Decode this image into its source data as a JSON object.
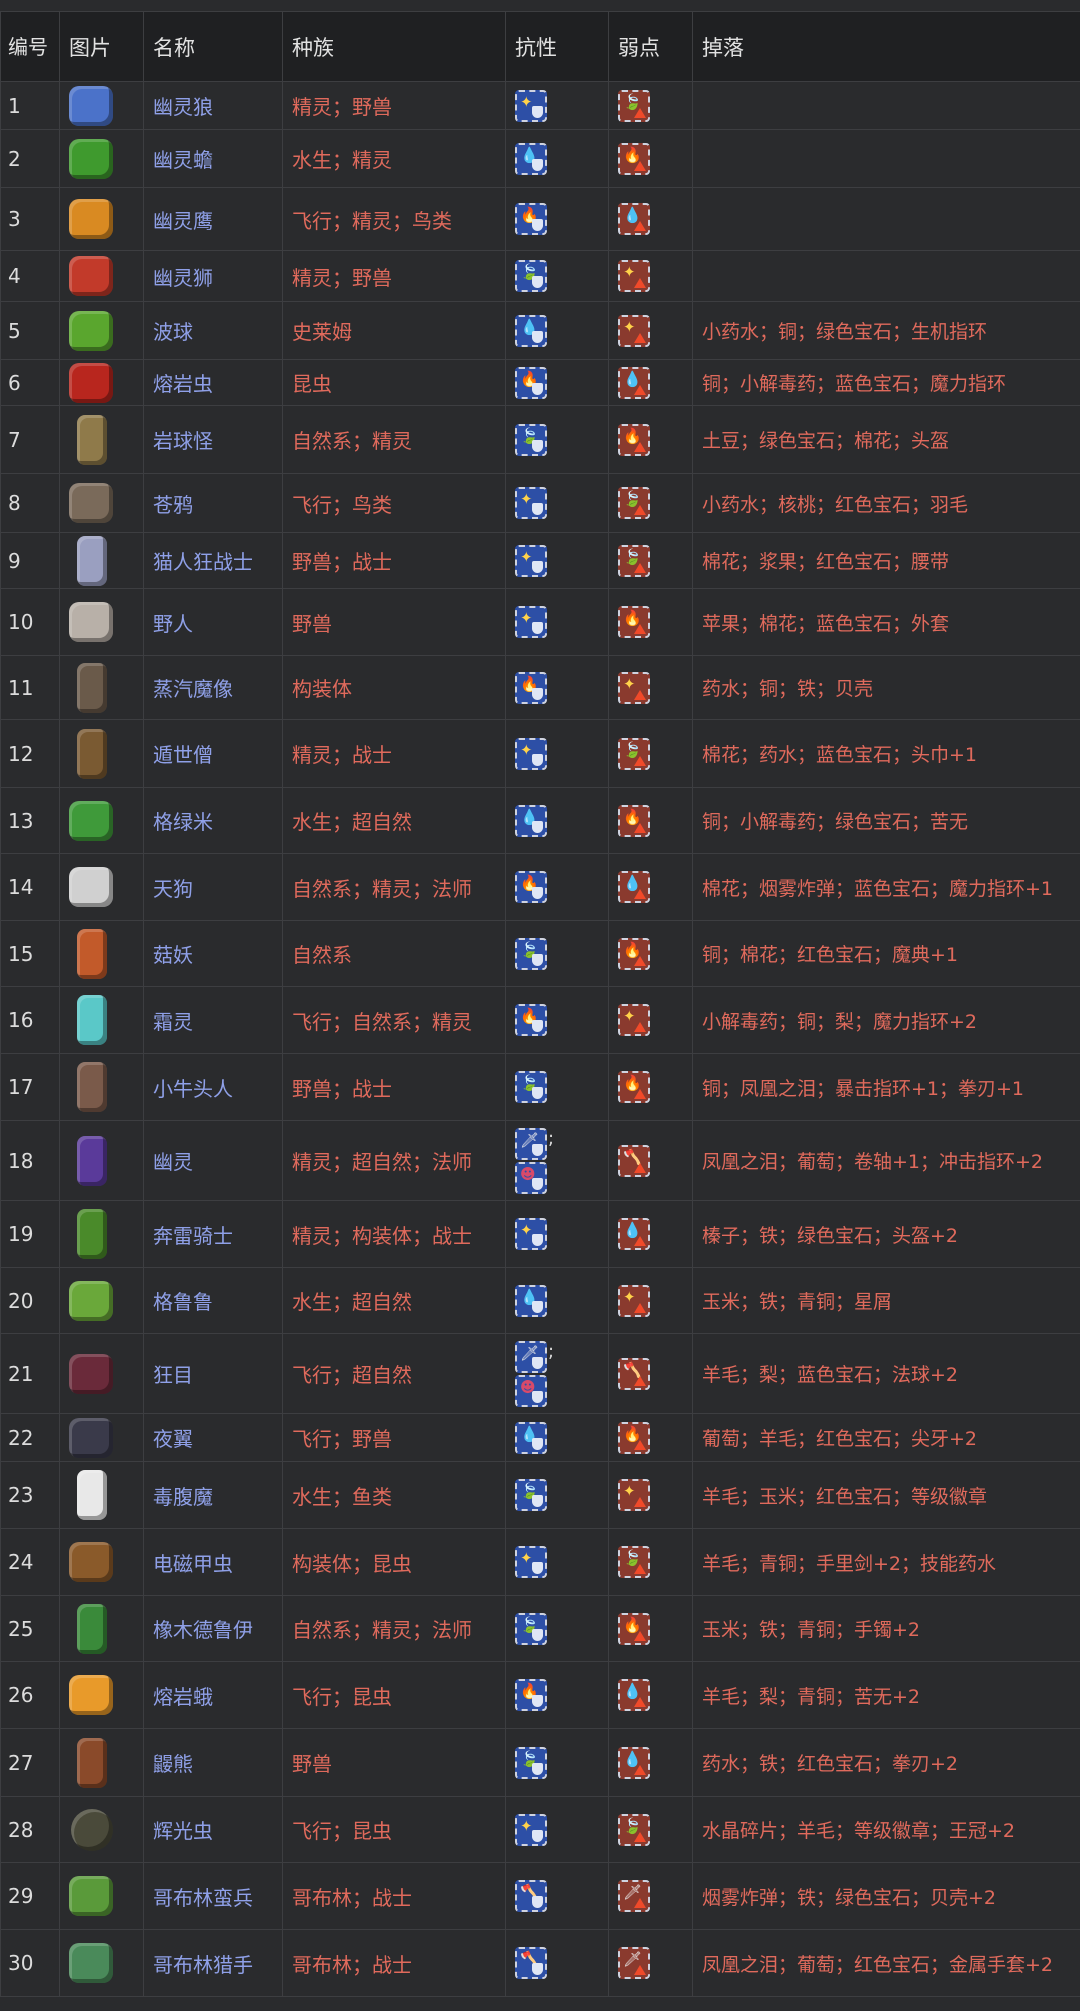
{
  "headers": {
    "id": "编号",
    "image": "图片",
    "name": "名称",
    "race": "种族",
    "resist": "抗性",
    "weak": "弱点",
    "drop": "掉落"
  },
  "icon_legend": {
    "water": "water-drop-icon",
    "fire": "flame-icon",
    "leaf": "leaf-icon",
    "light": "light-icon",
    "sword": "sword-icon",
    "axe": "axe-icon",
    "dark": "dark-icon"
  },
  "rows": [
    {
      "id": "1",
      "name": "幽灵狼",
      "race": "精灵；野兽",
      "resist": [
        "light"
      ],
      "weak": [
        "leaf"
      ],
      "drop": "",
      "color": "#4b72c9"
    },
    {
      "id": "2",
      "name": "幽灵蟾",
      "race": "水生；精灵",
      "resist": [
        "water"
      ],
      "weak": [
        "fire"
      ],
      "drop": "",
      "color": "#3f9a2e"
    },
    {
      "id": "3",
      "name": "幽灵鹰",
      "race": "飞行；精灵；鸟类",
      "resist": [
        "fire"
      ],
      "weak": [
        "water"
      ],
      "drop": "",
      "color": "#d98a22"
    },
    {
      "id": "4",
      "name": "幽灵狮",
      "race": "精灵；野兽",
      "resist": [
        "leaf"
      ],
      "weak": [
        "light"
      ],
      "drop": "",
      "color": "#c23a2a"
    },
    {
      "id": "5",
      "name": "波球",
      "race": "史莱姆",
      "resist": [
        "water"
      ],
      "weak": [
        "light"
      ],
      "drop": "小药水；铜；绿色宝石；生机指环",
      "color": "#5aa62e"
    },
    {
      "id": "6",
      "name": "熔岩虫",
      "race": "昆虫",
      "resist": [
        "fire"
      ],
      "weak": [
        "water"
      ],
      "drop": "铜；小解毒药；蓝色宝石；魔力指环",
      "color": "#b8261e"
    },
    {
      "id": "7",
      "name": "岩球怪",
      "race": "自然系；精灵",
      "resist": [
        "leaf"
      ],
      "weak": [
        "fire"
      ],
      "drop": "土豆；绿色宝石；棉花；头盔",
      "color": "#8f7a4a"
    },
    {
      "id": "8",
      "name": "苍鸦",
      "race": "飞行；鸟类",
      "resist": [
        "light"
      ],
      "weak": [
        "leaf"
      ],
      "drop": "小药水；核桃；红色宝石；羽毛",
      "color": "#7a6a5a"
    },
    {
      "id": "9",
      "name": "猫人狂战士",
      "race": "野兽；战士",
      "resist": [
        "light"
      ],
      "weak": [
        "leaf"
      ],
      "drop": "棉花；浆果；红色宝石；腰带",
      "color": "#9a9fc0"
    },
    {
      "id": "10",
      "name": "野人",
      "race": "野兽",
      "resist": [
        "light"
      ],
      "weak": [
        "fire"
      ],
      "drop": "苹果；棉花；蓝色宝石；外套",
      "color": "#b8b0a8"
    },
    {
      "id": "11",
      "name": "蒸汽魔像",
      "race": "构装体",
      "resist": [
        "fire"
      ],
      "weak": [
        "light"
      ],
      "drop": "药水；铜；铁；贝壳",
      "color": "#6a5a4a"
    },
    {
      "id": "12",
      "name": "遁世僧",
      "race": "精灵；战士",
      "resist": [
        "light"
      ],
      "weak": [
        "leaf"
      ],
      "drop": "棉花；药水；蓝色宝石；头巾+1",
      "color": "#7a5a32"
    },
    {
      "id": "13",
      "name": "格绿米",
      "race": "水生；超自然",
      "resist": [
        "water"
      ],
      "weak": [
        "fire"
      ],
      "drop": "铜；小解毒药；绿色宝石；苦无",
      "color": "#3f9a3a"
    },
    {
      "id": "14",
      "name": "天狗",
      "race": "自然系；精灵；法师",
      "resist": [
        "fire"
      ],
      "weak": [
        "water"
      ],
      "drop": "棉花；烟雾炸弹；蓝色宝石；魔力指环+1",
      "color": "#d0d0d0"
    },
    {
      "id": "15",
      "name": "菇妖",
      "race": "自然系",
      "resist": [
        "leaf"
      ],
      "weak": [
        "fire"
      ],
      "drop": "铜；棉花；红色宝石；魔典+1",
      "color": "#c25a2a"
    },
    {
      "id": "16",
      "name": "霜灵",
      "race": "飞行；自然系；精灵",
      "resist": [
        "fire"
      ],
      "weak": [
        "light"
      ],
      "drop": "小解毒药；铜；梨；魔力指环+2",
      "color": "#5ac8c8"
    },
    {
      "id": "17",
      "name": "小牛头人",
      "race": "野兽；战士",
      "resist": [
        "leaf"
      ],
      "weak": [
        "fire"
      ],
      "drop": "铜；凤凰之泪；暴击指环+1；拳刃+1",
      "color": "#7a5a4a"
    },
    {
      "id": "18",
      "name": "幽灵",
      "race": "精灵；超自然；法师",
      "resist": [
        "sword",
        "dark"
      ],
      "weak": [
        "axe"
      ],
      "drop": "凤凰之泪；葡萄；卷轴+1；冲击指环+2",
      "color": "#5a3a9a"
    },
    {
      "id": "19",
      "name": "奔雷骑士",
      "race": "精灵；构装体；战士",
      "resist": [
        "light"
      ],
      "weak": [
        "water"
      ],
      "drop": "榛子；铁；绿色宝石；头盔+2",
      "color": "#4a8a2a"
    },
    {
      "id": "20",
      "name": "格鲁鲁",
      "race": "水生；超自然",
      "resist": [
        "water"
      ],
      "weak": [
        "light"
      ],
      "drop": "玉米；铁；青铜；星屑",
      "color": "#6aa83a"
    },
    {
      "id": "21",
      "name": "狂目",
      "race": "飞行；超自然",
      "resist": [
        "sword",
        "dark"
      ],
      "weak": [
        "axe"
      ],
      "drop": "羊毛；梨；蓝色宝石；法球+2",
      "color": "#6a2a3a"
    },
    {
      "id": "22",
      "name": "夜翼",
      "race": "飞行；野兽",
      "resist": [
        "water"
      ],
      "weak": [
        "fire"
      ],
      "drop": "葡萄；羊毛；红色宝石；尖牙+2",
      "color": "#3a3a4a"
    },
    {
      "id": "23",
      "name": "毒腹魔",
      "race": "水生；鱼类",
      "resist": [
        "leaf"
      ],
      "weak": [
        "light"
      ],
      "drop": "羊毛；玉米；红色宝石；等级徽章",
      "color": "#e8e8e8"
    },
    {
      "id": "24",
      "name": "电磁甲虫",
      "race": "构装体；昆虫",
      "resist": [
        "light"
      ],
      "weak": [
        "leaf"
      ],
      "drop": "羊毛；青铜；手里剑+2；技能药水",
      "color": "#8a5a2a"
    },
    {
      "id": "25",
      "name": "橡木德鲁伊",
      "race": "自然系；精灵；法师",
      "resist": [
        "leaf"
      ],
      "weak": [
        "fire"
      ],
      "drop": "玉米；铁；青铜；手镯+2",
      "color": "#3a8a3a"
    },
    {
      "id": "26",
      "name": "熔岩蛾",
      "race": "飞行；昆虫",
      "resist": [
        "fire"
      ],
      "weak": [
        "water"
      ],
      "drop": "羊毛；梨；青铜；苦无+2",
      "color": "#e89a2a"
    },
    {
      "id": "27",
      "name": "鼹熊",
      "race": "野兽",
      "resist": [
        "leaf"
      ],
      "weak": [
        "water"
      ],
      "drop": "药水；铁；红色宝石；拳刃+2",
      "color": "#8a4a2a"
    },
    {
      "id": "28",
      "name": "辉光虫",
      "race": "飞行；昆虫",
      "resist": [
        "light"
      ],
      "weak": [
        "leaf"
      ],
      "drop": "水晶碎片；羊毛；等级徽章；王冠+2",
      "color": "#4a4a3a"
    },
    {
      "id": "29",
      "name": "哥布林蛮兵",
      "race": "哥布林；战士",
      "resist": [
        "axe"
      ],
      "weak": [
        "sword"
      ],
      "drop": "烟雾炸弹；铁；绿色宝石；贝壳+2",
      "color": "#5a9a3a"
    },
    {
      "id": "30",
      "name": "哥布林猎手",
      "race": "哥布林；战士",
      "resist": [
        "axe"
      ],
      "weak": [
        "sword"
      ],
      "drop": "凤凰之泪；葡萄；红色宝石；金属手套+2",
      "color": "#4a8a5a"
    }
  ]
}
